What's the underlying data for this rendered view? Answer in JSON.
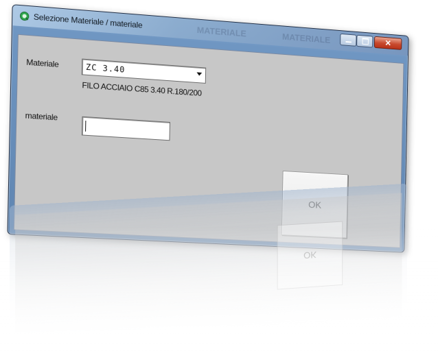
{
  "window": {
    "title": "Selezione Materiale / materiale",
    "background_title_fragments": [
      "MATERIALE",
      "MATERIALE"
    ],
    "controls": {
      "minimize": "minimize",
      "maximize": "maximize",
      "close_glyph": "✕"
    }
  },
  "form": {
    "materiale_label": "Materiale",
    "materiale_selected": "ZC 3.40",
    "materiale_description": "FILO ACCIAIO C85 3.40 R.180/200",
    "materiale_field_label": "materiale",
    "materiale_field_value": ""
  },
  "buttons": {
    "ok": "OK"
  },
  "reflection": {
    "ok": "OK"
  },
  "colors": {
    "client_bg": "#c7c7c7",
    "titlebar": "#8fb4d8",
    "close_button": "#c84a2e"
  },
  "icons": {
    "app": "app-icon",
    "dropdown": "chevron-down-icon"
  }
}
